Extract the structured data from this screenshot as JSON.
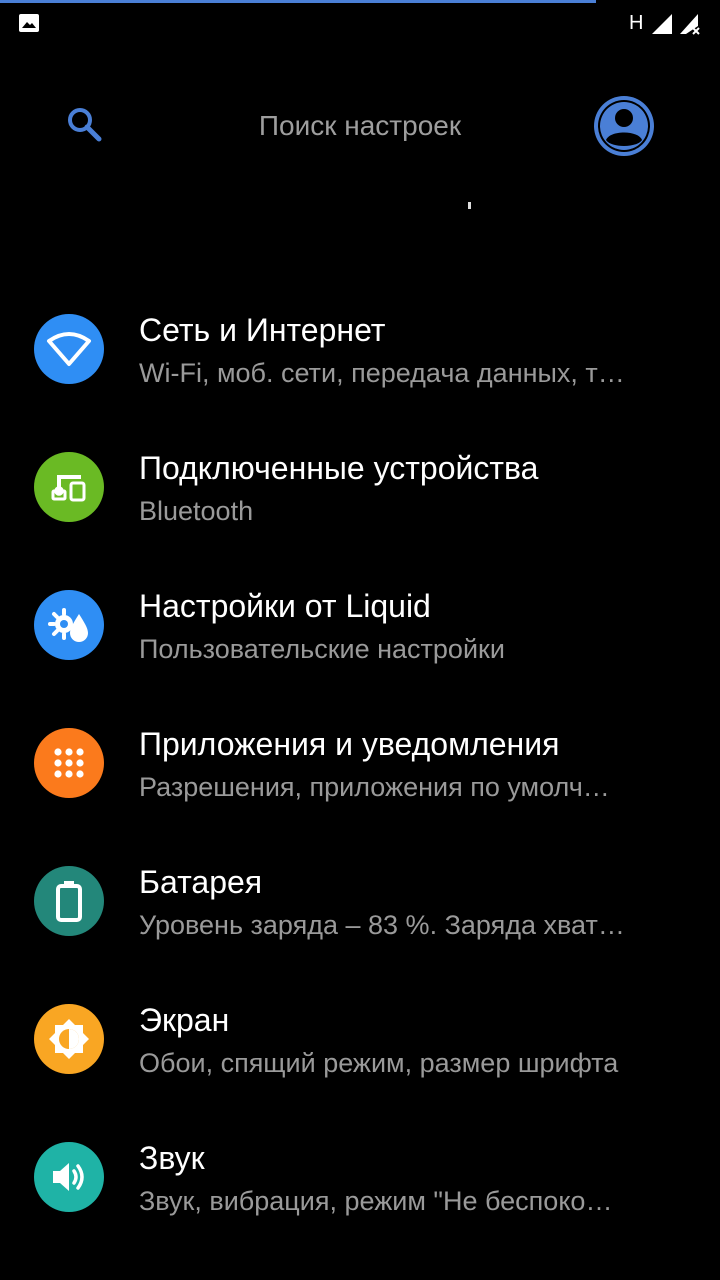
{
  "status_bar": {
    "network_type": "H",
    "icons": [
      "image-icon",
      "signal-icon",
      "signal-no-data-icon"
    ]
  },
  "search": {
    "placeholder": "Поиск настроек"
  },
  "colors": {
    "accent": "#4a7fd6",
    "background": "#000000",
    "wifi": "#2f8ef4",
    "devices": "#6aba24",
    "liquid": "#2f8ef4",
    "apps": "#fb7a1c",
    "battery": "#23877a",
    "display": "#f9a623",
    "sound": "#1fb3a6"
  },
  "settings": [
    {
      "icon": "wifi-icon",
      "title": "Сеть и Интернет",
      "subtitle": "Wi-Fi, моб. сети, передача данных, т…"
    },
    {
      "icon": "devices-icon",
      "title": "Подключенные устройства",
      "subtitle": "Bluetooth"
    },
    {
      "icon": "liquid-settings-icon",
      "title": "Настройки от Liquid",
      "subtitle": "Пользовательские настройки"
    },
    {
      "icon": "apps-icon",
      "title": "Приложения и уведомления",
      "subtitle": "Разрешения, приложения по умолч…"
    },
    {
      "icon": "battery-icon",
      "title": "Батарея",
      "subtitle": "Уровень заряда – 83 %. Заряда хват…"
    },
    {
      "icon": "display-icon",
      "title": "Экран",
      "subtitle": "Обои, спящий режим, размер шрифта"
    },
    {
      "icon": "sound-icon",
      "title": "Звук",
      "subtitle": "Звук, вибрация, режим \"Не беспоко…"
    }
  ]
}
